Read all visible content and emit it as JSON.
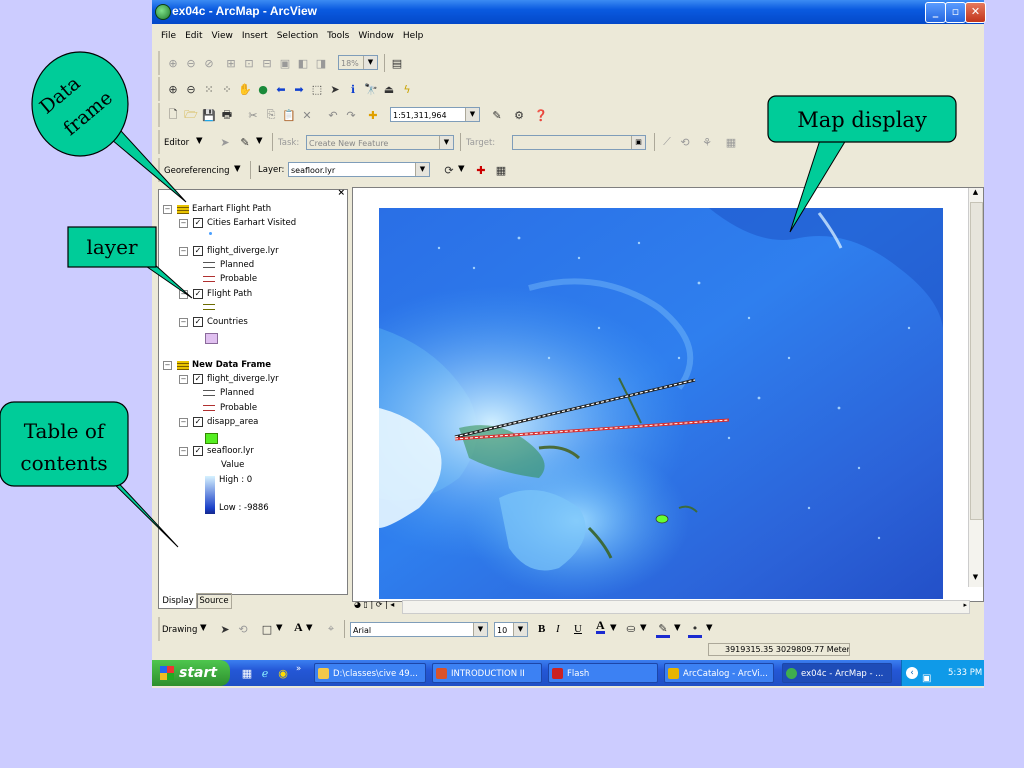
{
  "window": {
    "title": "ex04c - ArcMap - ArcView"
  },
  "menu": [
    "File",
    "Edit",
    "View",
    "Insert",
    "Selection",
    "Tools",
    "Window",
    "Help"
  ],
  "toolbar": {
    "zoom_percent": "18%",
    "scale": "1:51,311,964",
    "editor_label": "Editor",
    "task_label": "Task:",
    "task_value": "Create New Feature",
    "target_label": "Target:",
    "georef_label": "Georeferencing",
    "layer_label": "Layer:",
    "layer_value": "seafloor.lyr"
  },
  "toc": {
    "rows": [
      {
        "text": "Earhart Flight Path",
        "kind": "frame"
      },
      {
        "text": "Cities Earhart Visited",
        "kind": "layer"
      },
      {
        "text": "flight_diverge.lyr",
        "kind": "layer"
      },
      {
        "text": "Planned",
        "kind": "legend"
      },
      {
        "text": "Probable",
        "kind": "legend"
      },
      {
        "text": "Flight Path",
        "kind": "layer"
      },
      {
        "text": "Countries",
        "kind": "layer"
      },
      {
        "text": "New Data Frame",
        "kind": "frame"
      },
      {
        "text": "flight_diverge.lyr",
        "kind": "layer"
      },
      {
        "text": "Planned",
        "kind": "legend"
      },
      {
        "text": "Probable",
        "kind": "legend"
      },
      {
        "text": "disapp_area",
        "kind": "layer"
      },
      {
        "text": "seafloor.lyr",
        "kind": "layer"
      },
      {
        "text": "Value",
        "kind": "legend"
      },
      {
        "text": "High : 0",
        "kind": "legend"
      },
      {
        "text": "Low : -9886",
        "kind": "legend"
      }
    ],
    "tabs": [
      "Display",
      "Source"
    ]
  },
  "drawing": {
    "label": "Drawing",
    "font": "Arial",
    "size": "10",
    "bold": "B",
    "italic": "I",
    "underline": "U",
    "text_tool": "A"
  },
  "status": {
    "coords": "3919315.35  3029809.77 Meters"
  },
  "taskbar": {
    "start": "start",
    "items": [
      "D:\\classes\\cive 49...",
      "INTRODUCTION II",
      "Flash",
      "ArcCatalog - ArcVi...",
      "ex04c - ArcMap - ..."
    ],
    "clock": "5:33 PM"
  },
  "callouts": {
    "data_frame": [
      "Data",
      "frame"
    ],
    "layer": "layer",
    "toc": [
      "Table of",
      "contents"
    ],
    "map_display": "Map display"
  },
  "colors": {
    "callout_fill": "#00cc99",
    "slide_bg": "#ccccff",
    "titlebar": "#0a5ae0"
  }
}
